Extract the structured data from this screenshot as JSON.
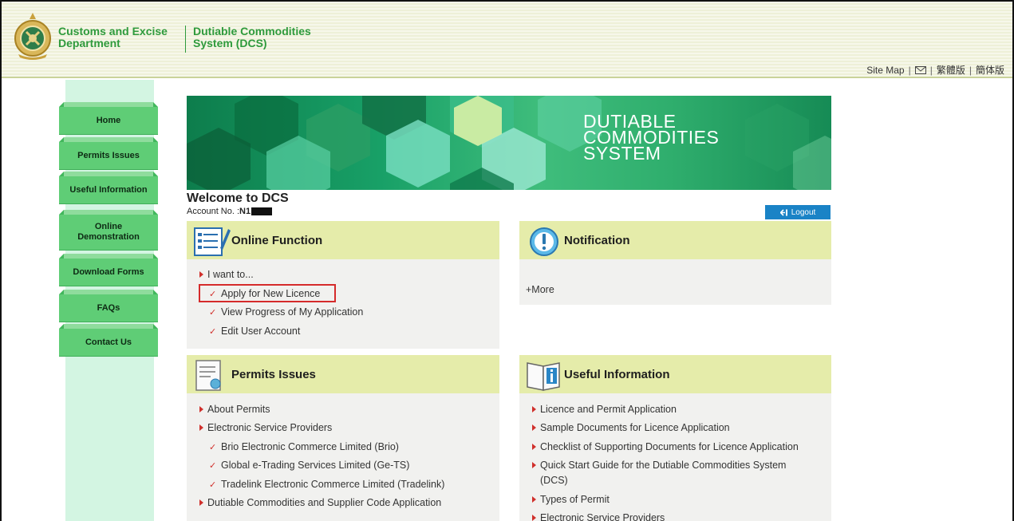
{
  "header": {
    "brand_line1a": "Customs and Excise",
    "brand_line1b": "Department",
    "brand_line2a": "Dutiable Commodities",
    "brand_line2b": "System (DCS)",
    "links": {
      "sitemap": "Site Map",
      "sep": "|",
      "traditional": "繁體版",
      "simplified": "簡体版"
    }
  },
  "nav": {
    "items": [
      {
        "label": "Home"
      },
      {
        "label": "Permits Issues"
      },
      {
        "label": "Useful Information"
      },
      {
        "label": "Online Demonstration"
      },
      {
        "label": "Download Forms"
      },
      {
        "label": "FAQs"
      },
      {
        "label": "Contact Us"
      }
    ]
  },
  "banner": {
    "line1": "DUTIABLE",
    "line2": "COMMODITIES",
    "line3": "SYSTEM"
  },
  "welcome": {
    "title": "Welcome to DCS",
    "account_label": "Account No. : ",
    "account_value": "N1",
    "logout": "Logout"
  },
  "online_function": {
    "title": "Online Function",
    "intro": "I want to...",
    "items": [
      "Apply for New Licence",
      "View Progress of My Application",
      "Edit User Account"
    ]
  },
  "notification": {
    "title": "Notification",
    "more": "+More"
  },
  "permits_issues": {
    "title": "Permits Issues",
    "about": "About Permits",
    "esp": "Electronic Service Providers",
    "providers": [
      "Brio Electronic Commerce Limited (Brio)",
      "Global e-Trading Services Limited (Ge-TS)",
      "Tradelink Electronic Commerce Limited (Tradelink)"
    ],
    "supplier": "Dutiable Commodities and Supplier Code Application"
  },
  "useful_information": {
    "title": "Useful Information",
    "items": [
      "Licence and Permit Application",
      "Sample Documents for Licence Application",
      "Checklist of Supporting Documents for Licence Application",
      "Quick Start Guide for the Dutiable Commodities System",
      "(DCS)",
      "Types of Permit",
      "Electronic Service Providers"
    ]
  },
  "colors": {
    "brand_green": "#2e9a3c",
    "nav_green": "#5fcd76",
    "panel_head": "#e5ecaa",
    "accent_red": "#d0302c",
    "logout_blue": "#1a83c6"
  }
}
